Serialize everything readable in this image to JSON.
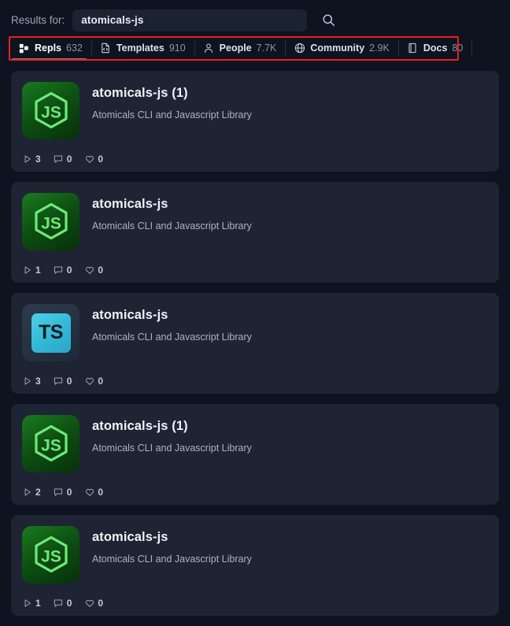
{
  "search": {
    "label": "Results for:",
    "value": "atomicals-js",
    "placeholder": "Search",
    "submit_icon": "search-icon"
  },
  "tabs": [
    {
      "label": "Repls",
      "count": "632",
      "icon": "replit-logo-icon",
      "active": true
    },
    {
      "label": "Templates",
      "count": "910",
      "icon": "file-code-icon",
      "active": false
    },
    {
      "label": "People",
      "count": "7.7K",
      "icon": "person-icon",
      "active": false
    },
    {
      "label": "Community",
      "count": "2.9K",
      "icon": "globe-icon",
      "active": false
    },
    {
      "label": "Docs",
      "count": "80",
      "icon": "book-icon",
      "active": false
    }
  ],
  "annotation": {
    "color": "#f01d1d",
    "target": "tab-bar"
  },
  "colors": {
    "page_background": "#0e1320",
    "card_background": "#1e2433",
    "accent_red": "#f01d1d",
    "js_green": "#6fe97a",
    "ts_cyan": "#3bc2dd"
  },
  "stat_labels": {
    "runs": "run-count",
    "comments": "comment-count",
    "likes": "like-count"
  },
  "results": [
    {
      "title": "atomicals-js (1)",
      "description": "Atomicals CLI and Javascript Library",
      "lang": "js",
      "lang_label": "JS",
      "runs": "3",
      "comments": "0",
      "likes": "0"
    },
    {
      "title": "atomicals-js",
      "description": "Atomicals CLI and Javascript Library",
      "lang": "js",
      "lang_label": "JS",
      "runs": "1",
      "comments": "0",
      "likes": "0"
    },
    {
      "title": "atomicals-js",
      "description": "Atomicals CLI and Javascript Library",
      "lang": "ts",
      "lang_label": "TS",
      "runs": "3",
      "comments": "0",
      "likes": "0"
    },
    {
      "title": "atomicals-js (1)",
      "description": "Atomicals CLI and Javascript Library",
      "lang": "js",
      "lang_label": "JS",
      "runs": "2",
      "comments": "0",
      "likes": "0"
    },
    {
      "title": "atomicals-js",
      "description": "Atomicals CLI and Javascript Library",
      "lang": "js",
      "lang_label": "JS",
      "runs": "1",
      "comments": "0",
      "likes": "0"
    }
  ]
}
